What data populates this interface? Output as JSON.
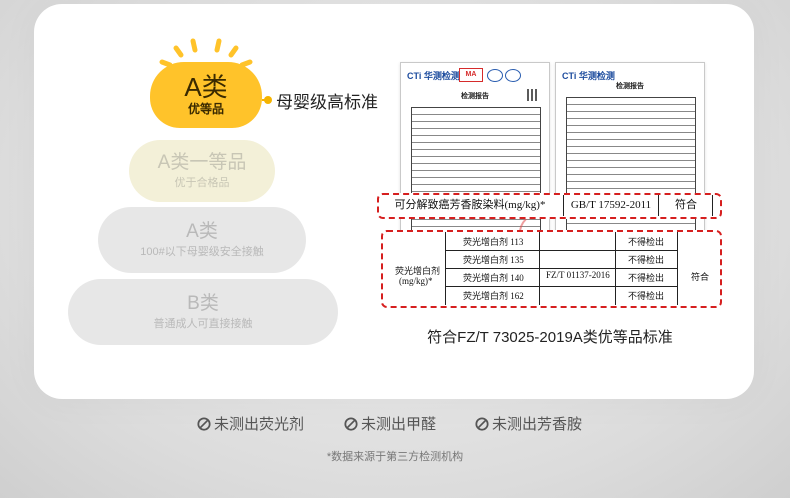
{
  "pyramid": {
    "top": {
      "main": "A类",
      "sub": "优等品"
    },
    "annotation": "母婴级高标准",
    "tier1": {
      "main": "A类一等品",
      "sub": "优于合格品"
    },
    "tier2": {
      "main": "A类",
      "sub": "100#以下母婴级安全接触"
    },
    "tier3": {
      "main": "B类",
      "sub": "普通成人可直接接触"
    }
  },
  "reports": {
    "doc1": {
      "brand": "CTi 华测检测",
      "title": "检测报告",
      "logo": "MA"
    },
    "doc2": {
      "brand": "CTi 华测检测",
      "title": "检测报告"
    }
  },
  "test_table_1": {
    "item": "可分解致癌芳香胺染料(mg/kg)*",
    "standard": "GB/T 17592-2011",
    "result": "符合"
  },
  "test_table_2": {
    "item_line1": "荧光增白剂",
    "item_line2": "(mg/kg)*",
    "rows": [
      {
        "name": "荧光增白剂 113",
        "value": "不得检出"
      },
      {
        "name": "荧光增白剂 135",
        "value": "不得检出"
      },
      {
        "name": "荧光增白剂 140",
        "value": "不得检出"
      },
      {
        "name": "荧光增白剂 162",
        "value": "不得检出"
      }
    ],
    "standard": "FZ/T 01137-2016",
    "result": "符合"
  },
  "standard_statement": "符合FZ/T 73025-2019A类优等品标准",
  "badges": [
    "未测出荧光剂",
    "未测出甲醛",
    "未测出芳香胺"
  ],
  "source_note": "*数据来源于第三方检测机构",
  "colors": {
    "accent": "#ffc32a",
    "highlight": "#d61f1f"
  }
}
